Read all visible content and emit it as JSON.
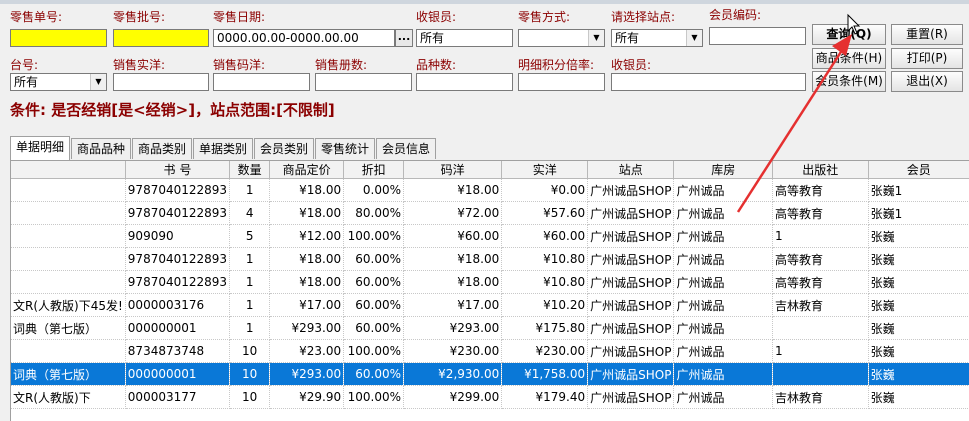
{
  "filters": {
    "retail_no": {
      "label": "零售单号:",
      "value": ""
    },
    "retail_batch": {
      "label": "零售批号:",
      "value": ""
    },
    "retail_date": {
      "label": "零售日期:",
      "value": "0000.00.00-0000.00.00",
      "button": "..."
    },
    "cashier": {
      "label": "收银员:",
      "value": "所有"
    },
    "retail_method": {
      "label": "零售方式:",
      "value": ""
    },
    "station": {
      "label": "请选择站点:",
      "value": "所有"
    },
    "member_code": {
      "label": "会员编码:",
      "value": ""
    },
    "terminal": {
      "label": "台号:",
      "value": "所有"
    },
    "sales_actual": {
      "label": "销售实洋:",
      "value": ""
    },
    "sales_code": {
      "label": "销售码洋:",
      "value": ""
    },
    "sales_volumes": {
      "label": "销售册数:",
      "value": ""
    },
    "kinds": {
      "label": "品种数:",
      "value": ""
    },
    "points_ratio": {
      "label": "明细积分倍率:",
      "value": ""
    },
    "cashier2": {
      "label": "收银员:",
      "value": ""
    }
  },
  "buttons": {
    "query": "查询(Q)",
    "reset": "重置(R)",
    "product_cond": "商品条件(H)",
    "print": "打印(P)",
    "member_cond": "会员条件(M)",
    "exit": "退出(X)"
  },
  "condition": "条件:  是否经销[是<经销>]，站点范围:[不限制]",
  "tabs": [
    "单据明细",
    "商品品种",
    "商品类别",
    "单据类别",
    "会员类别",
    "零售统计",
    "会员信息"
  ],
  "table": {
    "columns": [
      "",
      "书  号",
      "数量",
      "商品定价",
      "折扣",
      "码洋",
      "实洋",
      "站点",
      "库房",
      "出版社",
      "会员"
    ],
    "rows": [
      [
        "",
        "9787040122893",
        "1",
        "¥18.00",
        "0.00%",
        "¥18.00",
        "¥0.00",
        "广州诚品SHOP",
        "广州诚品",
        "高等教育",
        "张巍1"
      ],
      [
        "",
        "9787040122893",
        "4",
        "¥18.00",
        "80.00%",
        "¥72.00",
        "¥57.60",
        "广州诚品SHOP",
        "广州诚品",
        "高等教育",
        "张巍1"
      ],
      [
        "",
        "909090",
        "5",
        "¥12.00",
        "100.00%",
        "¥60.00",
        "¥60.00",
        "广州诚品SHOP",
        "广州诚品",
        "1",
        "张巍"
      ],
      [
        "",
        "9787040122893",
        "1",
        "¥18.00",
        "60.00%",
        "¥18.00",
        "¥10.80",
        "广州诚品SHOP",
        "广州诚品",
        "高等教育",
        "张巍"
      ],
      [
        "",
        "9787040122893",
        "1",
        "¥18.00",
        "60.00%",
        "¥18.00",
        "¥10.80",
        "广州诚品SHOP",
        "广州诚品",
        "高等教育",
        "张巍"
      ],
      [
        "文R(人教版)下45发!",
        "0000003176",
        "1",
        "¥17.00",
        "60.00%",
        "¥17.00",
        "¥10.20",
        "广州诚品SHOP",
        "广州诚品",
        "吉林教育",
        "张巍"
      ],
      [
        "词典（第七版）",
        "000000001",
        "1",
        "¥293.00",
        "60.00%",
        "¥293.00",
        "¥175.80",
        "广州诚品SHOP",
        "广州诚品",
        "",
        "张巍"
      ],
      [
        "",
        "8734873748",
        "10",
        "¥23.00",
        "100.00%",
        "¥230.00",
        "¥230.00",
        "广州诚品SHOP",
        "广州诚品",
        "1",
        "张巍"
      ],
      [
        "词典（第七版）",
        "000000001",
        "10",
        "¥293.00",
        "60.00%",
        "¥2,930.00",
        "¥1,758.00",
        "广州诚品SHOP",
        "广州诚品",
        "",
        "张巍"
      ],
      [
        "文R(人教版)下",
        "000003177",
        "10",
        "¥29.90",
        "100.00%",
        "¥299.00",
        "¥179.40",
        "广州诚品SHOP",
        "广州诚品",
        "吉林教育",
        "张巍"
      ]
    ],
    "selected_row": 8
  },
  "colors": {
    "label": "#8b0000",
    "selection": "#0a78d7",
    "highlight_input": "#ffff00",
    "annotation_arrow": "#e53030"
  }
}
